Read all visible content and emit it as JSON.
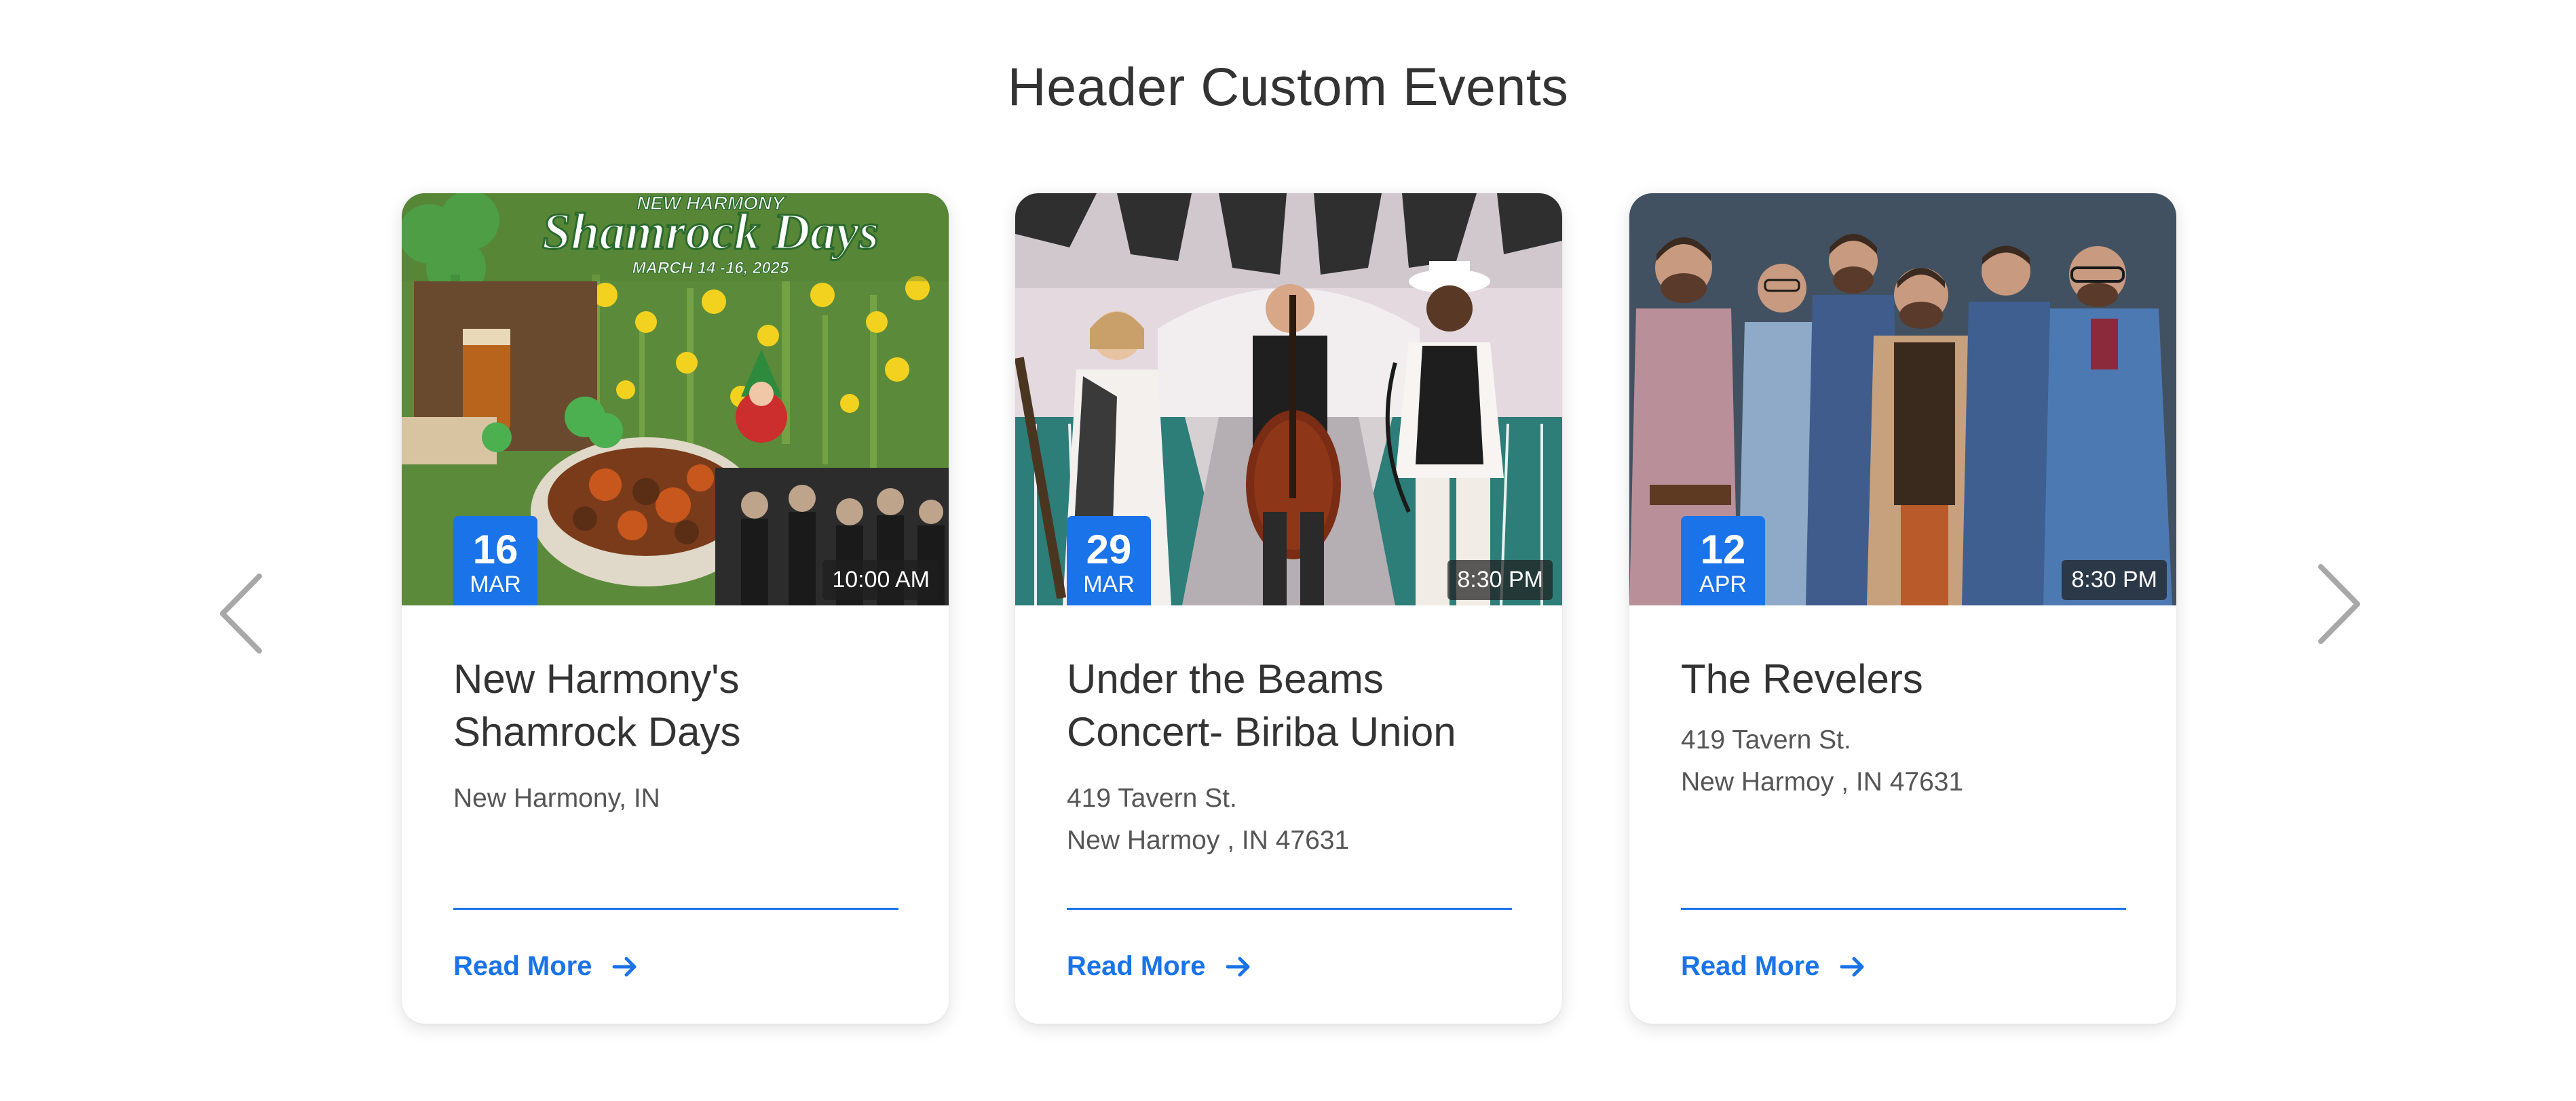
{
  "section": {
    "title": "Header Custom Events"
  },
  "colors": {
    "accent": "#1a73e8",
    "text": "#333333",
    "muted": "#555555"
  },
  "icons": {
    "prev": "chevron-left-icon",
    "next": "chevron-right-icon",
    "read_more": "arrow-right-icon"
  },
  "events": [
    {
      "day": "16",
      "month": "MAR",
      "time": "10:00 AM",
      "title": "New Harmony's Shamrock Days",
      "address_line1": "New Harmony, IN",
      "address_line2": "",
      "read_more": "Read More",
      "poster_banner_top": "NEW HARMONY",
      "poster_banner_main": "Shamrock Days",
      "poster_banner_dates": "MARCH 14 -16, 2025"
    },
    {
      "day": "29",
      "month": "MAR",
      "time": "8:30 PM",
      "title": "Under the Beams Concert- Biriba Union",
      "address_line1": "419 Tavern St.",
      "address_line2": "New Harmoy , IN 47631",
      "read_more": "Read More"
    },
    {
      "day": "12",
      "month": "APR",
      "time": "8:30 PM",
      "title": "The Revelers",
      "address_line1": "419 Tavern St.",
      "address_line2": "New Harmoy , IN 47631",
      "read_more": "Read More"
    }
  ]
}
